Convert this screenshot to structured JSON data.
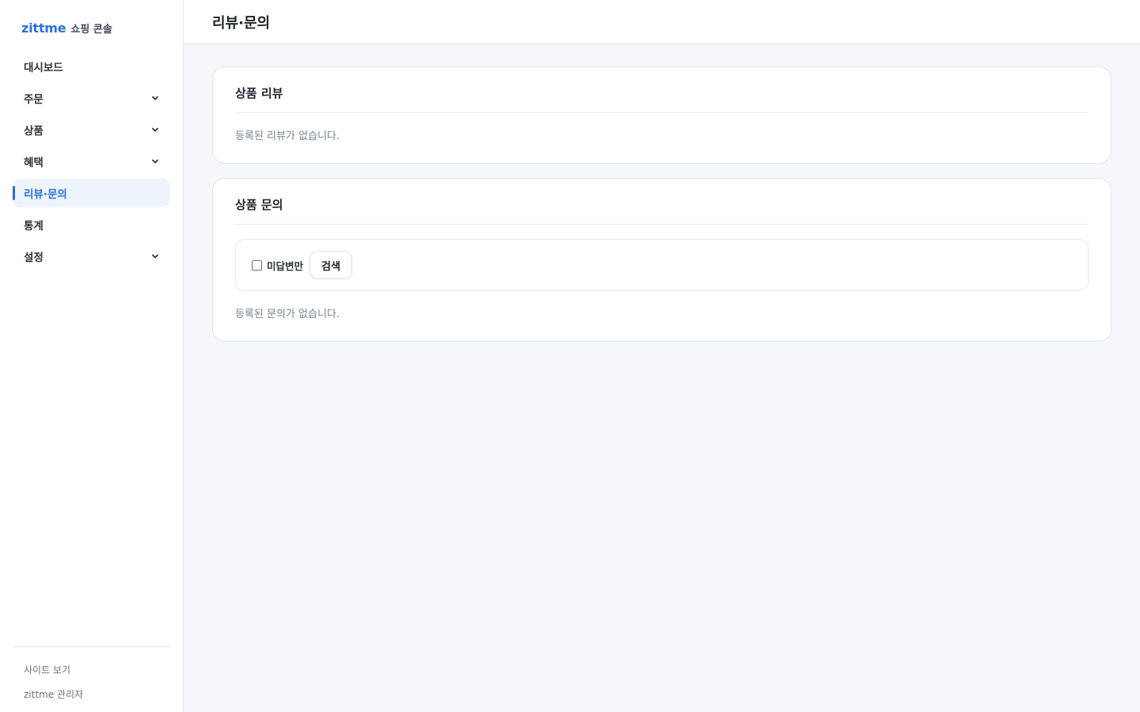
{
  "brand": {
    "logo": "zittme",
    "subtitle": "쇼핑 콘솔"
  },
  "sidebar": {
    "items": [
      {
        "label": "대시보드",
        "has_chevron": false,
        "active": false
      },
      {
        "label": "주문",
        "has_chevron": true,
        "active": false
      },
      {
        "label": "상품",
        "has_chevron": true,
        "active": false
      },
      {
        "label": "혜택",
        "has_chevron": true,
        "active": false
      },
      {
        "label": "리뷰·문의",
        "has_chevron": false,
        "active": true
      },
      {
        "label": "통계",
        "has_chevron": false,
        "active": false
      },
      {
        "label": "설정",
        "has_chevron": true,
        "active": false
      }
    ],
    "footer": {
      "site_link": "사이트 보기",
      "user": "zittme 관리자"
    }
  },
  "header": {
    "title": "리뷰·문의"
  },
  "reviews": {
    "title": "상품 리뷰",
    "empty": "등록된 리뷰가 없습니다."
  },
  "inquiries": {
    "title": "상품 문의",
    "filter": {
      "unanswered_label": "미답변만",
      "unanswered_checked": false,
      "search_label": "검색"
    },
    "empty": "등록된 문의가 없습니다."
  },
  "colors": {
    "accent": "#2b6fd6",
    "active_bg": "#eef4fc",
    "page_bg": "#f5f7fa"
  }
}
